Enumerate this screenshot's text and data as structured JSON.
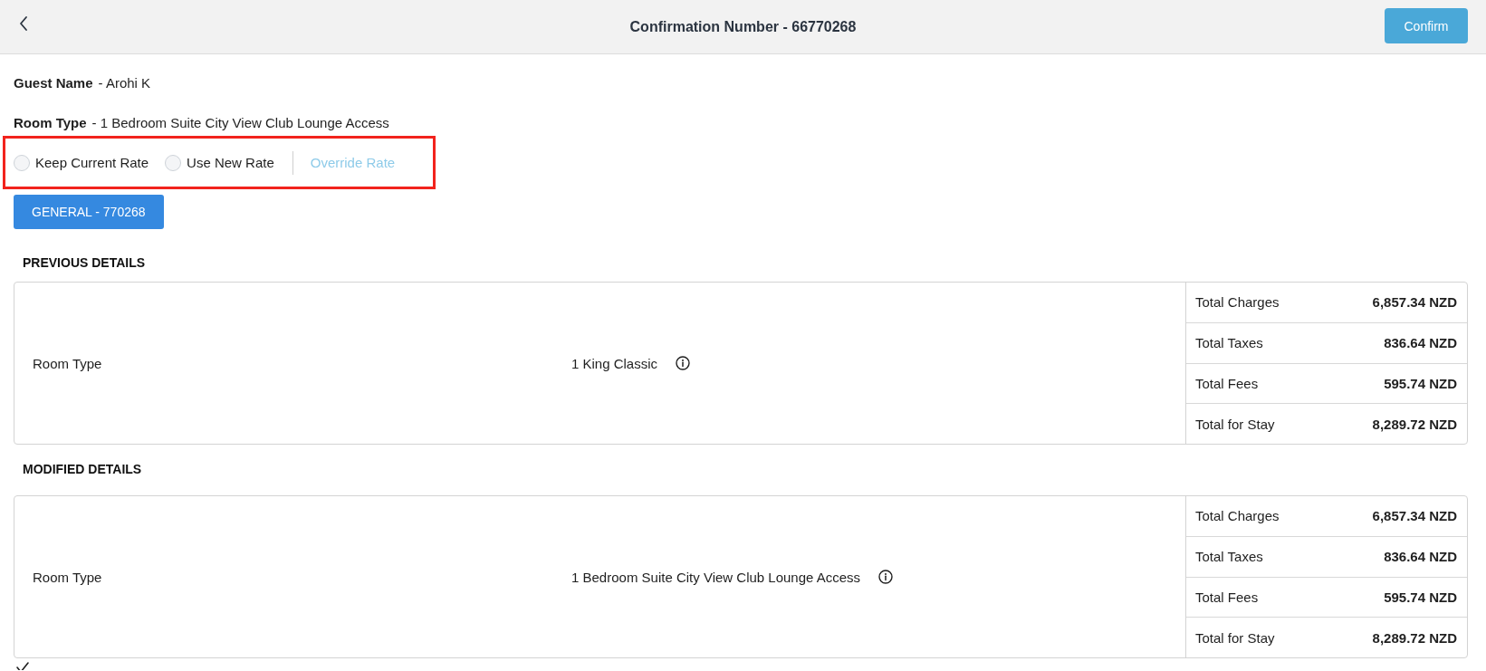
{
  "header": {
    "title": "Confirmation Number - 66770268",
    "confirm_button": "Confirm"
  },
  "guest": {
    "label": "Guest Name",
    "value": "- Arohi K"
  },
  "room_type": {
    "label": "Room Type",
    "value": "- 1 Bedroom Suite City View Club Lounge Access"
  },
  "rate_options": {
    "highlighted": true,
    "options": [
      {
        "kind": "radio",
        "label": "Keep Current Rate",
        "selected": false
      },
      {
        "kind": "radio",
        "label": "Use New Rate",
        "selected": false
      },
      {
        "kind": "link",
        "label": "Override Rate",
        "disabled": true
      }
    ]
  },
  "rate_plan_button": "GENERAL - 770268",
  "sections": [
    {
      "title": "PREVIOUS DETAILS",
      "row": {
        "label": "Room Type",
        "value": "1 King Classic"
      },
      "totals": [
        {
          "label": "Total Charges",
          "value": "6,857.34 NZD"
        },
        {
          "label": "Total Taxes",
          "value": "836.64 NZD"
        },
        {
          "label": "Total Fees",
          "value": "595.74 NZD"
        },
        {
          "label": "Total for Stay",
          "value": "8,289.72 NZD"
        }
      ]
    },
    {
      "title": "MODIFIED DETAILS",
      "row": {
        "label": "Room Type",
        "value": "1 Bedroom Suite City View Club Lounge Access"
      },
      "totals": [
        {
          "label": "Total Charges",
          "value": "6,857.34 NZD"
        },
        {
          "label": "Total Taxes",
          "value": "836.64 NZD"
        },
        {
          "label": "Total Fees",
          "value": "595.74 NZD"
        },
        {
          "label": "Total for Stay",
          "value": "8,289.72 NZD"
        }
      ]
    }
  ]
}
